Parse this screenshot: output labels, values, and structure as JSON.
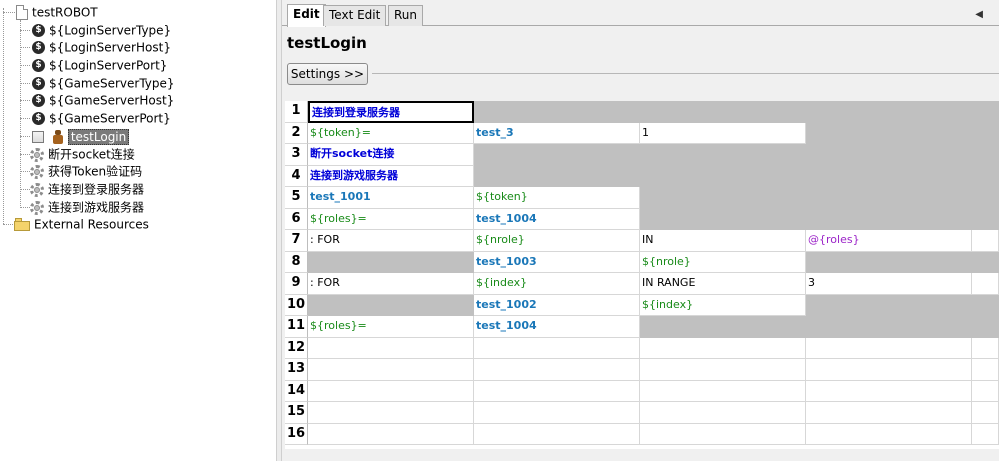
{
  "tree": {
    "root": {
      "label": "testROBOT",
      "icon": "document-icon"
    },
    "variables": [
      {
        "label": "${LoginServerType}",
        "icon": "variable-icon"
      },
      {
        "label": "${LoginServerHost}",
        "icon": "variable-icon"
      },
      {
        "label": "${LoginServerPort}",
        "icon": "variable-icon"
      },
      {
        "label": "${GameServerType}",
        "icon": "variable-icon"
      },
      {
        "label": "${GameServerHost}",
        "icon": "variable-icon"
      },
      {
        "label": "${GameServerPort}",
        "icon": "variable-icon"
      }
    ],
    "testcase": {
      "label": "testLogin",
      "icon": "robot-icon",
      "selected": true
    },
    "keywords": [
      {
        "label": "断开socket连接",
        "icon": "gear-icon"
      },
      {
        "label": "获得Token验证码",
        "icon": "gear-icon"
      },
      {
        "label": "连接到登录服务器",
        "icon": "gear-icon"
      },
      {
        "label": "连接到游戏服务器",
        "icon": "gear-icon"
      }
    ],
    "external": {
      "label": "External Resources",
      "icon": "folder-icon"
    }
  },
  "editor": {
    "tabs": [
      {
        "label": "Edit",
        "active": true
      },
      {
        "label": "Text Edit",
        "active": false
      },
      {
        "label": "Run",
        "active": false
      }
    ],
    "test_name": "testLogin",
    "settings_label": "Settings >>",
    "colors": {
      "keyword": "#0000d8",
      "variable": "#178a17",
      "list_variable": "#9b22c8",
      "user_keyword": "#1a77b8",
      "empty_cell": "#c0c0c0"
    },
    "rows": [
      {
        "n": "1",
        "cells": [
          {
            "t": "连接到登录服务器",
            "c": "kw",
            "sel": true
          },
          {
            "g": true
          },
          {
            "g": true
          },
          {
            "g": true
          },
          {
            "g": true
          }
        ]
      },
      {
        "n": "2",
        "cells": [
          {
            "t": "${token}=",
            "c": "var"
          },
          {
            "t": "test_3",
            "c": "kw2"
          },
          {
            "t": "1",
            "c": "plain"
          },
          {
            "g": true
          },
          {
            "g": true
          }
        ]
      },
      {
        "n": "3",
        "cells": [
          {
            "t": "断开socket连接",
            "c": "kw"
          },
          {
            "g": true
          },
          {
            "g": true
          },
          {
            "g": true
          },
          {
            "g": true
          }
        ]
      },
      {
        "n": "4",
        "cells": [
          {
            "t": "连接到游戏服务器",
            "c": "kw"
          },
          {
            "g": true
          },
          {
            "g": true
          },
          {
            "g": true
          },
          {
            "g": true
          }
        ]
      },
      {
        "n": "5",
        "cells": [
          {
            "t": "test_1001",
            "c": "kw2"
          },
          {
            "t": "${token}",
            "c": "var"
          },
          {
            "g": true
          },
          {
            "g": true
          },
          {
            "g": true
          }
        ]
      },
      {
        "n": "6",
        "cells": [
          {
            "t": "${roles}=",
            "c": "var"
          },
          {
            "t": "test_1004",
            "c": "kw2"
          },
          {
            "g": true
          },
          {
            "g": true
          },
          {
            "g": true
          }
        ]
      },
      {
        "n": "7",
        "cells": [
          {
            "t": ": FOR",
            "c": "plain"
          },
          {
            "t": "${nrole}",
            "c": "var"
          },
          {
            "t": "IN",
            "c": "plain"
          },
          {
            "t": "@{roles}",
            "c": "list"
          },
          {
            "t": "",
            "c": "plain"
          }
        ]
      },
      {
        "n": "8",
        "cells": [
          {
            "g": true
          },
          {
            "t": "test_1003",
            "c": "kw2"
          },
          {
            "t": "${nrole}",
            "c": "var"
          },
          {
            "g": true
          },
          {
            "g": true
          }
        ]
      },
      {
        "n": "9",
        "cells": [
          {
            "t": ": FOR",
            "c": "plain"
          },
          {
            "t": "${index}",
            "c": "var"
          },
          {
            "t": "IN RANGE",
            "c": "plain"
          },
          {
            "t": "3",
            "c": "plain"
          },
          {
            "t": "",
            "c": "plain"
          }
        ]
      },
      {
        "n": "10",
        "cells": [
          {
            "g": true
          },
          {
            "t": "test_1002",
            "c": "kw2"
          },
          {
            "t": "${index}",
            "c": "var"
          },
          {
            "g": true
          },
          {
            "g": true
          }
        ]
      },
      {
        "n": "11",
        "cells": [
          {
            "t": "${roles}=",
            "c": "var"
          },
          {
            "t": "test_1004",
            "c": "kw2"
          },
          {
            "g": true
          },
          {
            "g": true
          },
          {
            "g": true
          }
        ]
      },
      {
        "n": "12",
        "cells": [
          {
            "t": ""
          },
          {
            "t": ""
          },
          {
            "t": ""
          },
          {
            "t": ""
          },
          {
            "t": ""
          }
        ]
      },
      {
        "n": "13",
        "cells": [
          {
            "t": ""
          },
          {
            "t": ""
          },
          {
            "t": ""
          },
          {
            "t": ""
          },
          {
            "t": ""
          }
        ]
      },
      {
        "n": "14",
        "cells": [
          {
            "t": ""
          },
          {
            "t": ""
          },
          {
            "t": ""
          },
          {
            "t": ""
          },
          {
            "t": ""
          }
        ]
      },
      {
        "n": "15",
        "cells": [
          {
            "t": ""
          },
          {
            "t": ""
          },
          {
            "t": ""
          },
          {
            "t": ""
          },
          {
            "t": ""
          }
        ]
      },
      {
        "n": "16",
        "cells": [
          {
            "t": ""
          },
          {
            "t": ""
          },
          {
            "t": ""
          },
          {
            "t": ""
          },
          {
            "t": ""
          }
        ]
      }
    ]
  }
}
